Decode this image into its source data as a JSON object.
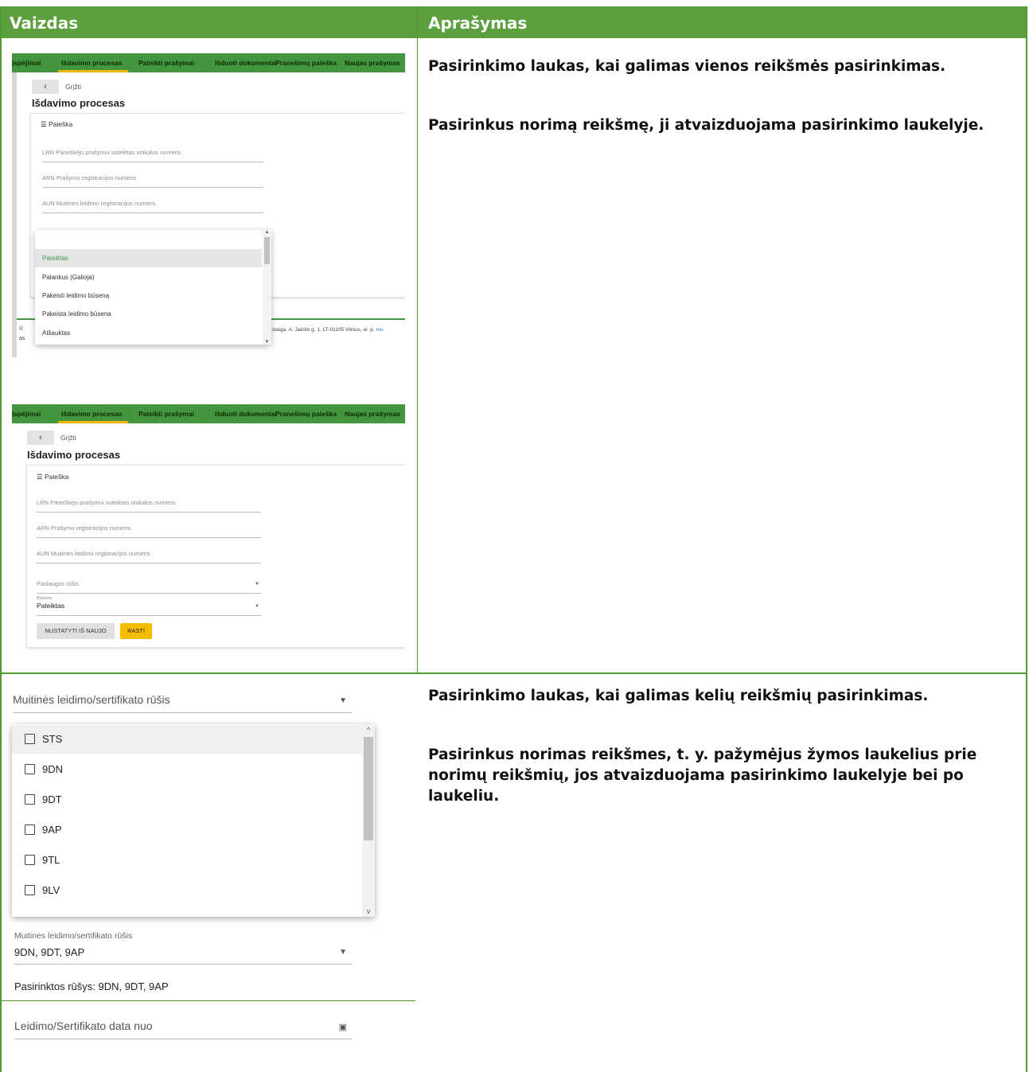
{
  "header": {
    "col_view": "Vaizdas",
    "col_desc": "Aprašymas"
  },
  "row1": {
    "desc_p1": "Pasirinkimo laukas, kai galimas vienos reikšmės pasirinkimas.",
    "desc_p2": "Pasirinkus norimą reikšmę, ji atvaizduojama pasirinkimo laukelyje."
  },
  "app": {
    "nav": [
      "Įspėjimai",
      "Išdavimo procesas",
      "Pateikti prašymai",
      "Išduoti dokumentai",
      "Pranešimų paieška",
      "Naujas prašymas"
    ],
    "back_icon": "chevron-left-icon",
    "back_label": "Grįžti",
    "page_title": "Išdavimo procesas",
    "filter_label": "Paieška",
    "lrn": "LRN Pareiškėjo prašymui suteiktas unikalus numeris",
    "arn": "ARN Prašymo registracijos numeris",
    "aun": "AUN Muitinės leidimo registracijos numeris",
    "service_type": "Paslaugos rūšis",
    "status_label": "Būsena",
    "status_value": "Pateiktas",
    "reset_btn": "NUSTATYTI IŠ NAUJO",
    "find_btn": "RASTI",
    "footer_left1": "©",
    "footer_left2": "as",
    "footer_text": "staiga. A. Jakšto g. 1, LT-01105 Vilnius, el. p.",
    "footer_link": "mu"
  },
  "dropdown1": {
    "options": [
      "Pateiktas",
      "Palankus (Galioja)",
      "Pakeisti leidimo būseną",
      "Pakeista leidimo būsena",
      "Atšauktas"
    ]
  },
  "row2": {
    "desc_p1": "Pasirinkimo laukas, kai galimas kelių reikšmių pasirinkimas.",
    "desc_p2": "Pasirinkus norimas reikšmes, t. y. pažymėjus žymos laukelius prie norimų reikšmių, jos atvaizduojama pasirinkimo laukelyje bei po laukeliu."
  },
  "multi": {
    "placeholder": "Muitinės leidimo/sertifikato rūšis",
    "options": [
      "STS",
      "9DN",
      "9DT",
      "9AP",
      "9TL",
      "9LV"
    ],
    "label": "Muitinės leidimo/sertifikato rūšis",
    "value": "9DN, 9DT, 9AP",
    "selected_note": "Pasirinktos rūšys: 9DN, 9DT, 9AP"
  },
  "date_field": {
    "label": "Leidimo/Sertifikato data nuo",
    "icon": "calendar-icon"
  },
  "colors": {
    "accent": "#5ba03c",
    "nav": "#43953f",
    "active": "#f3b600"
  }
}
